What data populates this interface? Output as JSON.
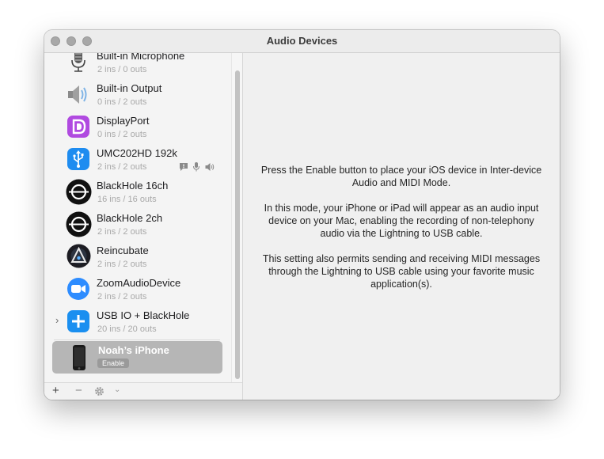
{
  "window": {
    "title": "Audio Devices"
  },
  "devices": [
    {
      "name": "Built-in Microphone",
      "io": "2 ins / 0 outs",
      "icon": "microphone-icon"
    },
    {
      "name": "Built-in Output",
      "io": "0 ins / 2 outs",
      "icon": "speaker-icon"
    },
    {
      "name": "DisplayPort",
      "io": "0 ins / 2 outs",
      "icon": "displayport-icon"
    },
    {
      "name": "UMC202HD 192k",
      "io": "2 ins / 2 outs",
      "icon": "usb-icon"
    },
    {
      "name": "BlackHole 16ch",
      "io": "16 ins / 16 outs",
      "icon": "blackhole-icon"
    },
    {
      "name": "BlackHole 2ch",
      "io": "2 ins / 2 outs",
      "icon": "blackhole-icon"
    },
    {
      "name": "Reincubate",
      "io": "2 ins / 2 outs",
      "icon": "reincubate-icon"
    },
    {
      "name": "ZoomAudioDevice",
      "io": "2 ins / 2 outs",
      "icon": "zoom-camera-icon"
    },
    {
      "name": "USB IO + BlackHole",
      "io": "20 ins / 20 outs",
      "icon": "aggregate-plus-icon"
    }
  ],
  "iphone": {
    "name": "Noah’s iPhone",
    "enable_label": "Enable",
    "icon": "iphone-icon"
  },
  "toolbar": {
    "add": "+",
    "remove": "−",
    "caret": "⌄"
  },
  "message": {
    "p1": "Press the Enable button to place your iOS device in Inter-device Audio and MIDI Mode.",
    "p2": "In this mode, your iPhone or iPad will appear as an audio input device on your Mac, enabling the recording of non-telephony audio via the Lightning to USB cable.",
    "p3": "This setting also permits sending and receiving MIDI messages through the Lightning to USB cable using your favorite music application(s)."
  },
  "colors": {
    "displayport": "#b04ae0",
    "usb": "#1e8cf0",
    "zoom": "#2d8cff",
    "aggregate": "#1a8ff0",
    "blackhole": "#111111"
  }
}
